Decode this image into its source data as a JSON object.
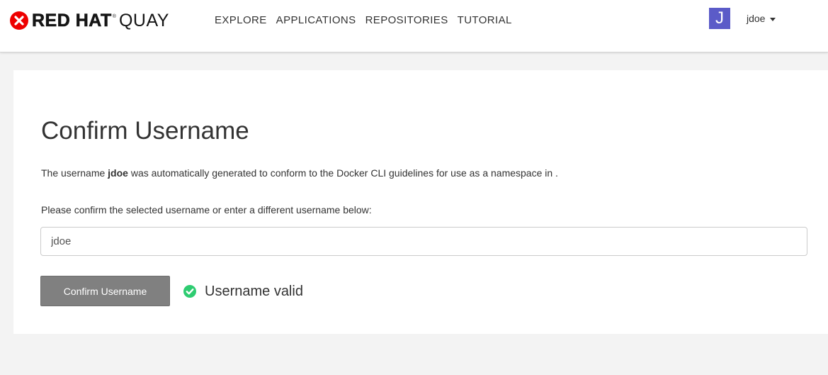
{
  "brand": {
    "name_bold": "RED HAT",
    "registered": "®",
    "name_light": "QUAY",
    "logo_color": "#ee0000"
  },
  "nav": {
    "links": [
      "EXPLORE",
      "APPLICATIONS",
      "REPOSITORIES",
      "TUTORIAL"
    ]
  },
  "user": {
    "avatar_letter": "J",
    "avatar_color": "#5b5bc8",
    "name": "jdoe"
  },
  "main": {
    "title": "Confirm Username",
    "desc_prefix": "The username ",
    "desc_username": "jdoe",
    "desc_suffix": " was automatically generated to conform to the Docker CLI guidelines for use as a namespace in .",
    "prompt": "Please confirm the selected username or enter a different username below:",
    "input_value": "jdoe",
    "confirm_label": "Confirm Username",
    "status_text": "Username valid",
    "status_icon": "check-circle-icon",
    "status_color": "#2ecc71"
  }
}
